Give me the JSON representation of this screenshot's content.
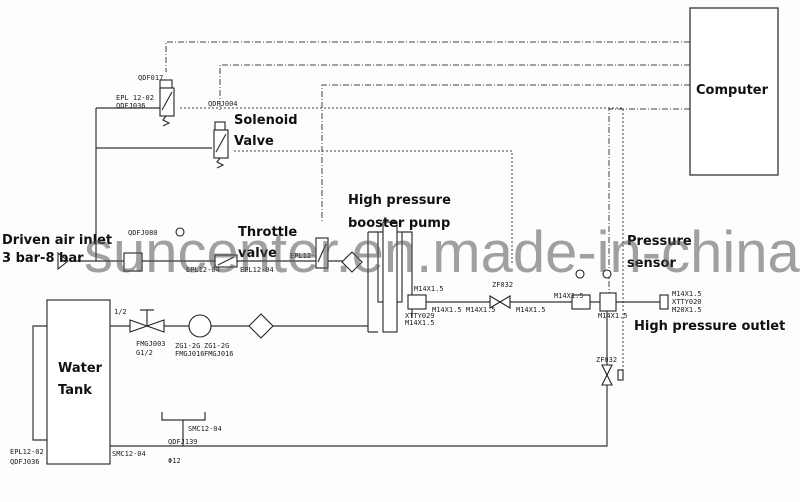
{
  "labels": {
    "computer": "Computer",
    "solenoid_1": "Solenoid",
    "solenoid_2": "Valve",
    "throttle_1": "Throttle",
    "throttle_2": "valve",
    "booster_1": "High pressure",
    "booster_2": "booster pump",
    "inlet_1": "Driven air inlet",
    "inlet_2": "3 bar-8 bar",
    "sensor_1": "Pressure",
    "sensor_2": "sensor",
    "outlet": "High pressure outlet",
    "tank_1": "Water",
    "tank_2": "Tank"
  },
  "codes": {
    "qdf017": "QDF017",
    "epl1202": "EPL 12-02",
    "qdfj036": "QDFJ036",
    "qdfj004": "QDFJ004",
    "qdfj080": "QDFJ080",
    "epl1204_a": "EPL12-04",
    "epl1204_b": "EPL12-04",
    "epl1204_c": "EPL12-04",
    "m14_a": "M14X1.5",
    "m14_b": "M14X1.5",
    "m14_c": "M14X1.5",
    "m14_d": "M14X1.5",
    "m14_e": "M14X1.5",
    "m14_f": "M14X1.5",
    "m14_g": "M14X1.5",
    "xtty029": "XTTY029",
    "zf032_a": "ZF032",
    "zf032_b": "ZF032",
    "outlet_1": "M14X1.5",
    "outlet_2": "XTTY020",
    "outlet_3": "M20X1.5",
    "half": "1/2",
    "fmgj003": "FMGJ003",
    "g12": "G1/2",
    "zg1": "ZG1-2G",
    "fmgj016_a": "FMGJ016",
    "zg2": "ZG1-2G",
    "fmgj016_b": "FMGJ016",
    "smc_a": "SMC12-04",
    "qdfj139": "QDFJ139",
    "phi12": "Φ12",
    "smc_b": "SMC12-04",
    "epl1202_b": "EPL12-02",
    "qdfj036_b": "QDFJ036"
  },
  "watermark": "suncenter.en.made-in-china.com"
}
